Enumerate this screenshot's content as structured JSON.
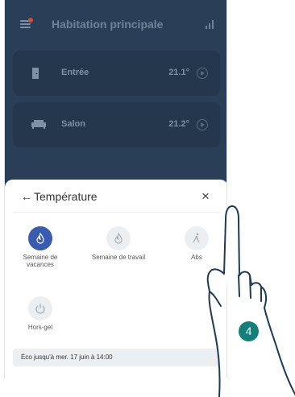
{
  "header": {
    "title": "Habitation principale",
    "menu_icon": "hamburger-menu-icon",
    "stats_icon": "bar-chart-icon"
  },
  "rooms": [
    {
      "name": "Entrée",
      "temperature": "21.1°",
      "icon": "door-icon"
    },
    {
      "name": "Salon",
      "temperature": "21.2°",
      "icon": "sofa-icon"
    }
  ],
  "sheet": {
    "back_symbol": "←",
    "title": "Température",
    "close_symbol": "×",
    "modes": [
      {
        "label": "Semaine de vacances",
        "icon": "flame-icon",
        "active": true
      },
      {
        "label": "Semaine de travail",
        "icon": "flame-icon",
        "active": false
      },
      {
        "label": "Abs",
        "icon": "walking-person-icon",
        "active": false
      },
      {
        "label": "Hors-gel",
        "icon": "power-icon",
        "active": false
      }
    ],
    "status": "Éco jusqu'à mer. 17 juin à 14:00"
  },
  "step_number": "4",
  "colors": {
    "app_background": "#2a3f57",
    "card_background": "#24374d",
    "active_mode": "#3b5bb0",
    "step_badge": "#15807a",
    "notification_dot": "#d24b3d"
  }
}
